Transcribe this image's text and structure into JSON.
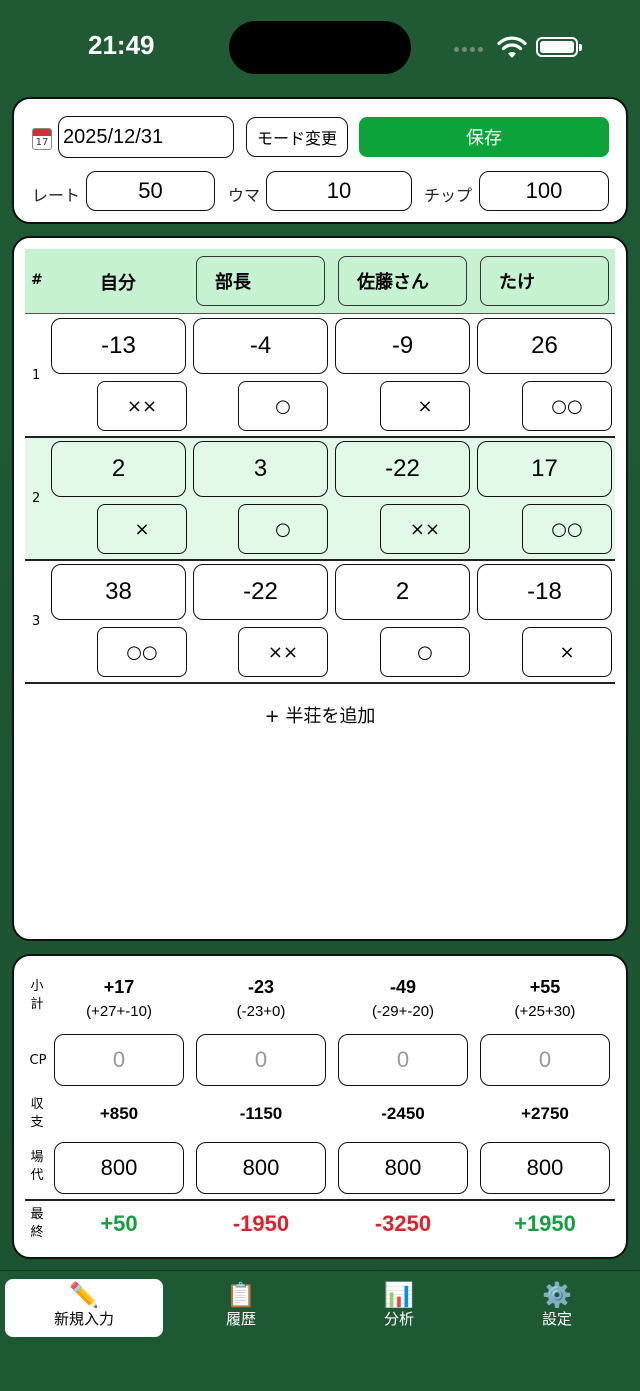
{
  "status": {
    "time": "21:49"
  },
  "top": {
    "date": "2025/12/31",
    "calendar_day": "17",
    "mode_button": "モード変更",
    "save_button": "保存",
    "rate_label": "レート",
    "rate": "50",
    "uma_label": "ウマ",
    "uma": "10",
    "chip_label": "チップ",
    "chip": "100"
  },
  "table": {
    "hash": "#",
    "players": [
      "自分",
      "部長",
      "佐藤さん",
      "たけ"
    ],
    "rows": [
      {
        "num": "1",
        "scores": [
          "-13",
          "-4",
          "-9",
          "26"
        ],
        "marks": [
          "××",
          "○",
          "×",
          "○○"
        ]
      },
      {
        "num": "2",
        "scores": [
          "2",
          "3",
          "-22",
          "17"
        ],
        "marks": [
          "×",
          "○",
          "××",
          "○○"
        ]
      },
      {
        "num": "3",
        "scores": [
          "38",
          "-22",
          "2",
          "-18"
        ],
        "marks": [
          "○○",
          "××",
          "○",
          "×"
        ]
      }
    ],
    "add_button": "+ 半荘を追加"
  },
  "summary": {
    "subtotal_label": [
      "小",
      "計"
    ],
    "cp_label": "CP",
    "shushi_label": [
      "収",
      "支"
    ],
    "bada_label": [
      "場",
      "代"
    ],
    "final_label": [
      "最",
      "終"
    ],
    "subtotal": [
      "+17",
      "-23",
      "-49",
      "+55"
    ],
    "subtotal_detail": [
      "(+27+-10)",
      "(-23+0)",
      "(-29+-20)",
      "(+25+30)"
    ],
    "cp": [
      "0",
      "0",
      "0",
      "0"
    ],
    "shushi": [
      "+850",
      "-1150",
      "-2450",
      "+2750"
    ],
    "bada": [
      "800",
      "800",
      "800",
      "800"
    ],
    "final": [
      "+50",
      "-1950",
      "-3250",
      "+1950"
    ]
  },
  "tabs": [
    {
      "label": "新規入力",
      "icon": "pencil-icon"
    },
    {
      "label": "履歴",
      "icon": "clipboard-icon"
    },
    {
      "label": "分析",
      "icon": "chart-icon"
    },
    {
      "label": "設定",
      "icon": "gear-icon"
    }
  ],
  "colors": {
    "positive": "#14a040",
    "negative": "#e0202a",
    "accent": "#0ba33a",
    "highlight": "#c7f2d1"
  }
}
